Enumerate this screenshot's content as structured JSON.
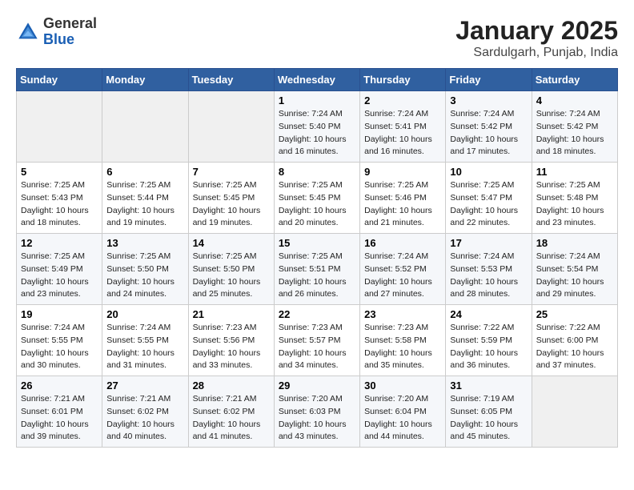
{
  "header": {
    "logo_general": "General",
    "logo_blue": "Blue",
    "month_year": "January 2025",
    "location": "Sardulgarh, Punjab, India"
  },
  "days_of_week": [
    "Sunday",
    "Monday",
    "Tuesday",
    "Wednesday",
    "Thursday",
    "Friday",
    "Saturday"
  ],
  "weeks": [
    [
      {
        "day": null
      },
      {
        "day": null
      },
      {
        "day": null
      },
      {
        "day": "1",
        "sunrise": "Sunrise: 7:24 AM",
        "sunset": "Sunset: 5:40 PM",
        "daylight": "Daylight: 10 hours and 16 minutes."
      },
      {
        "day": "2",
        "sunrise": "Sunrise: 7:24 AM",
        "sunset": "Sunset: 5:41 PM",
        "daylight": "Daylight: 10 hours and 16 minutes."
      },
      {
        "day": "3",
        "sunrise": "Sunrise: 7:24 AM",
        "sunset": "Sunset: 5:42 PM",
        "daylight": "Daylight: 10 hours and 17 minutes."
      },
      {
        "day": "4",
        "sunrise": "Sunrise: 7:24 AM",
        "sunset": "Sunset: 5:42 PM",
        "daylight": "Daylight: 10 hours and 18 minutes."
      }
    ],
    [
      {
        "day": "5",
        "sunrise": "Sunrise: 7:25 AM",
        "sunset": "Sunset: 5:43 PM",
        "daylight": "Daylight: 10 hours and 18 minutes."
      },
      {
        "day": "6",
        "sunrise": "Sunrise: 7:25 AM",
        "sunset": "Sunset: 5:44 PM",
        "daylight": "Daylight: 10 hours and 19 minutes."
      },
      {
        "day": "7",
        "sunrise": "Sunrise: 7:25 AM",
        "sunset": "Sunset: 5:45 PM",
        "daylight": "Daylight: 10 hours and 19 minutes."
      },
      {
        "day": "8",
        "sunrise": "Sunrise: 7:25 AM",
        "sunset": "Sunset: 5:45 PM",
        "daylight": "Daylight: 10 hours and 20 minutes."
      },
      {
        "day": "9",
        "sunrise": "Sunrise: 7:25 AM",
        "sunset": "Sunset: 5:46 PM",
        "daylight": "Daylight: 10 hours and 21 minutes."
      },
      {
        "day": "10",
        "sunrise": "Sunrise: 7:25 AM",
        "sunset": "Sunset: 5:47 PM",
        "daylight": "Daylight: 10 hours and 22 minutes."
      },
      {
        "day": "11",
        "sunrise": "Sunrise: 7:25 AM",
        "sunset": "Sunset: 5:48 PM",
        "daylight": "Daylight: 10 hours and 23 minutes."
      }
    ],
    [
      {
        "day": "12",
        "sunrise": "Sunrise: 7:25 AM",
        "sunset": "Sunset: 5:49 PM",
        "daylight": "Daylight: 10 hours and 23 minutes."
      },
      {
        "day": "13",
        "sunrise": "Sunrise: 7:25 AM",
        "sunset": "Sunset: 5:50 PM",
        "daylight": "Daylight: 10 hours and 24 minutes."
      },
      {
        "day": "14",
        "sunrise": "Sunrise: 7:25 AM",
        "sunset": "Sunset: 5:50 PM",
        "daylight": "Daylight: 10 hours and 25 minutes."
      },
      {
        "day": "15",
        "sunrise": "Sunrise: 7:25 AM",
        "sunset": "Sunset: 5:51 PM",
        "daylight": "Daylight: 10 hours and 26 minutes."
      },
      {
        "day": "16",
        "sunrise": "Sunrise: 7:24 AM",
        "sunset": "Sunset: 5:52 PM",
        "daylight": "Daylight: 10 hours and 27 minutes."
      },
      {
        "day": "17",
        "sunrise": "Sunrise: 7:24 AM",
        "sunset": "Sunset: 5:53 PM",
        "daylight": "Daylight: 10 hours and 28 minutes."
      },
      {
        "day": "18",
        "sunrise": "Sunrise: 7:24 AM",
        "sunset": "Sunset: 5:54 PM",
        "daylight": "Daylight: 10 hours and 29 minutes."
      }
    ],
    [
      {
        "day": "19",
        "sunrise": "Sunrise: 7:24 AM",
        "sunset": "Sunset: 5:55 PM",
        "daylight": "Daylight: 10 hours and 30 minutes."
      },
      {
        "day": "20",
        "sunrise": "Sunrise: 7:24 AM",
        "sunset": "Sunset: 5:55 PM",
        "daylight": "Daylight: 10 hours and 31 minutes."
      },
      {
        "day": "21",
        "sunrise": "Sunrise: 7:23 AM",
        "sunset": "Sunset: 5:56 PM",
        "daylight": "Daylight: 10 hours and 33 minutes."
      },
      {
        "day": "22",
        "sunrise": "Sunrise: 7:23 AM",
        "sunset": "Sunset: 5:57 PM",
        "daylight": "Daylight: 10 hours and 34 minutes."
      },
      {
        "day": "23",
        "sunrise": "Sunrise: 7:23 AM",
        "sunset": "Sunset: 5:58 PM",
        "daylight": "Daylight: 10 hours and 35 minutes."
      },
      {
        "day": "24",
        "sunrise": "Sunrise: 7:22 AM",
        "sunset": "Sunset: 5:59 PM",
        "daylight": "Daylight: 10 hours and 36 minutes."
      },
      {
        "day": "25",
        "sunrise": "Sunrise: 7:22 AM",
        "sunset": "Sunset: 6:00 PM",
        "daylight": "Daylight: 10 hours and 37 minutes."
      }
    ],
    [
      {
        "day": "26",
        "sunrise": "Sunrise: 7:21 AM",
        "sunset": "Sunset: 6:01 PM",
        "daylight": "Daylight: 10 hours and 39 minutes."
      },
      {
        "day": "27",
        "sunrise": "Sunrise: 7:21 AM",
        "sunset": "Sunset: 6:02 PM",
        "daylight": "Daylight: 10 hours and 40 minutes."
      },
      {
        "day": "28",
        "sunrise": "Sunrise: 7:21 AM",
        "sunset": "Sunset: 6:02 PM",
        "daylight": "Daylight: 10 hours and 41 minutes."
      },
      {
        "day": "29",
        "sunrise": "Sunrise: 7:20 AM",
        "sunset": "Sunset: 6:03 PM",
        "daylight": "Daylight: 10 hours and 43 minutes."
      },
      {
        "day": "30",
        "sunrise": "Sunrise: 7:20 AM",
        "sunset": "Sunset: 6:04 PM",
        "daylight": "Daylight: 10 hours and 44 minutes."
      },
      {
        "day": "31",
        "sunrise": "Sunrise: 7:19 AM",
        "sunset": "Sunset: 6:05 PM",
        "daylight": "Daylight: 10 hours and 45 minutes."
      },
      {
        "day": null
      }
    ]
  ]
}
